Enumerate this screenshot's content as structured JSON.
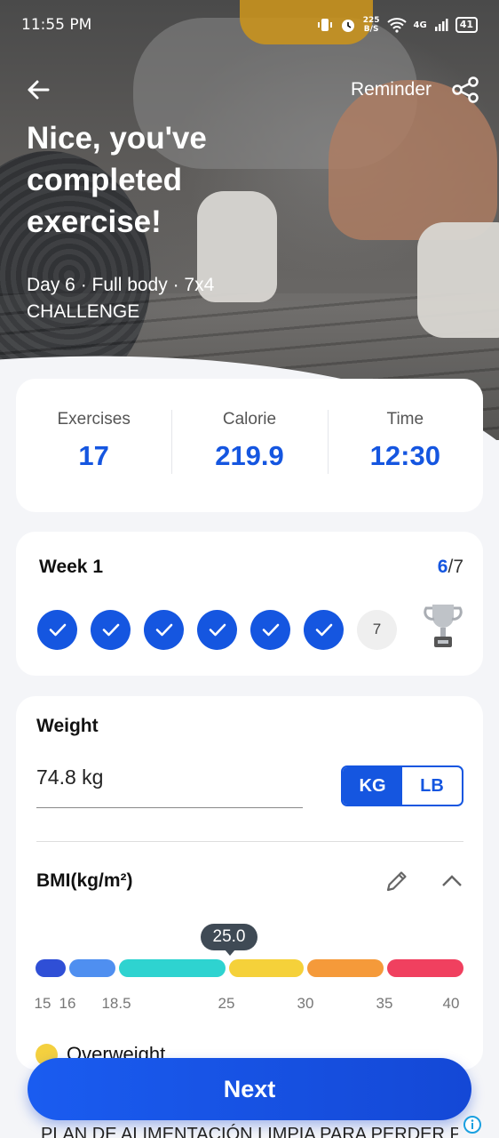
{
  "status_bar": {
    "time": "11:55 PM",
    "network_speed_value": "225",
    "network_speed_unit": "B/S",
    "network_type": "4G",
    "battery": "41"
  },
  "nav": {
    "reminder_label": "Reminder",
    "back_icon": "arrow-left-icon",
    "share_icon": "share-icon"
  },
  "hero": {
    "title": "Nice, you've completed exercise!",
    "subtitle_line1": "Day 6 · Full body · 7x4",
    "subtitle_line2": "CHALLENGE"
  },
  "stats": [
    {
      "label": "Exercises",
      "value": "17"
    },
    {
      "label": "Calorie",
      "value": "219.9"
    },
    {
      "label": "Time",
      "value": "12:30"
    }
  ],
  "week": {
    "title": "Week 1",
    "completed": "6",
    "total": "/7",
    "pending_day": "7",
    "completed_days": 6
  },
  "weight": {
    "title": "Weight",
    "value": "74.8 kg",
    "unit_kg": "KG",
    "unit_lb": "LB",
    "selected_unit": "KG"
  },
  "bmi": {
    "title": "BMI(kg/m²)",
    "value": "25.0",
    "ticks": [
      "15",
      "16",
      "18.5",
      "25",
      "30",
      "35",
      "40"
    ],
    "category": "Overweight",
    "colors": {
      "severe_underweight": "#2f4fd6",
      "underweight": "#4f8ff0",
      "normal": "#2ed3d0",
      "overweight": "#f5d13a",
      "obese1": "#f59a3a",
      "obese2": "#f0405f",
      "indicator": "#f4d03f"
    }
  },
  "actions": {
    "next_label": "Next"
  },
  "ad": {
    "text": "PLAN DE ALIMENTACIÓN LIMPIA PARA PERDER PESO"
  },
  "colors": {
    "accent": "#1556e0"
  }
}
